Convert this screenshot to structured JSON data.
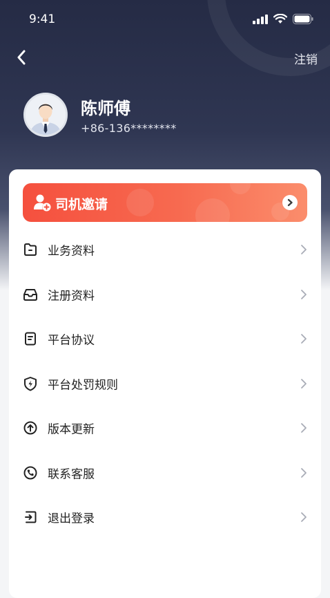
{
  "status_bar": {
    "time": "9:41"
  },
  "header": {
    "logout_label": "注销"
  },
  "profile": {
    "name": "陈师傅",
    "phone": "+86-136********"
  },
  "invite": {
    "label": "司机邀请"
  },
  "menu": [
    {
      "label": "业务资料",
      "icon": "folder-icon"
    },
    {
      "label": "注册资料",
      "icon": "inbox-icon"
    },
    {
      "label": "平台协议",
      "icon": "document-icon"
    },
    {
      "label": "平台处罚规则",
      "icon": "shield-bolt-icon"
    },
    {
      "label": "版本更新",
      "icon": "arrow-up-circle-icon"
    },
    {
      "label": "联系客服",
      "icon": "phone-icon"
    },
    {
      "label": "退出登录",
      "icon": "exit-icon"
    }
  ],
  "colors": {
    "accent": "#f5503e",
    "header": "#252b45",
    "text": "#222222"
  }
}
